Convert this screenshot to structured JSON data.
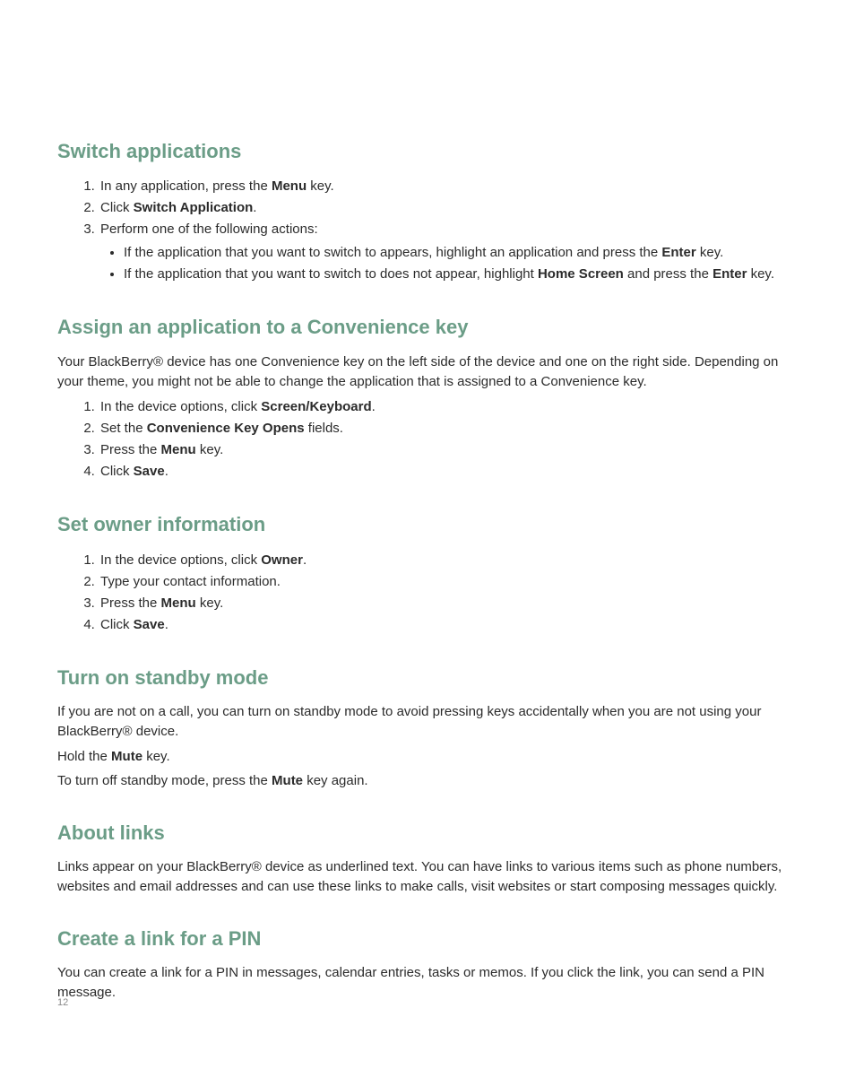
{
  "page_number": "12",
  "sections": [
    {
      "heading": "Switch applications",
      "paragraphs": [],
      "list": {
        "type": "ol",
        "items": [
          {
            "parts": [
              {
                "t": "In any application, press the "
              },
              {
                "b": "Menu"
              },
              {
                "t": " key."
              }
            ]
          },
          {
            "parts": [
              {
                "t": "Click "
              },
              {
                "b": "Switch Application"
              },
              {
                "t": "."
              }
            ]
          },
          {
            "parts": [
              {
                "t": "Perform one of the following actions:"
              }
            ],
            "sublist": {
              "type": "ul",
              "items": [
                {
                  "parts": [
                    {
                      "t": "If the application that you want to switch to appears, highlight an application and press the "
                    },
                    {
                      "b": "Enter"
                    },
                    {
                      "t": " key."
                    }
                  ]
                },
                {
                  "parts": [
                    {
                      "t": "If the application that you want to switch to does not appear, highlight "
                    },
                    {
                      "b": "Home Screen"
                    },
                    {
                      "t": " and press the "
                    },
                    {
                      "b": "Enter"
                    },
                    {
                      "t": " key."
                    }
                  ]
                }
              ]
            }
          }
        ]
      },
      "post_paragraphs": []
    },
    {
      "heading": "Assign an application to a Convenience key",
      "paragraphs": [
        {
          "parts": [
            {
              "t": "Your BlackBerry® device has one Convenience key on the left side of the device and one on the right side. Depending on your theme, you might not be able to change the application that is assigned to a Convenience key."
            }
          ]
        }
      ],
      "list": {
        "type": "ol",
        "items": [
          {
            "parts": [
              {
                "t": "In the device options, click "
              },
              {
                "b": "Screen/Keyboard"
              },
              {
                "t": "."
              }
            ]
          },
          {
            "parts": [
              {
                "t": "Set the "
              },
              {
                "b": "Convenience Key Opens"
              },
              {
                "t": " fields."
              }
            ]
          },
          {
            "parts": [
              {
                "t": "Press the "
              },
              {
                "b": "Menu"
              },
              {
                "t": " key."
              }
            ]
          },
          {
            "parts": [
              {
                "t": "Click "
              },
              {
                "b": "Save"
              },
              {
                "t": "."
              }
            ]
          }
        ]
      },
      "post_paragraphs": []
    },
    {
      "heading": "Set owner information",
      "paragraphs": [],
      "list": {
        "type": "ol",
        "items": [
          {
            "parts": [
              {
                "t": "In the device options, click "
              },
              {
                "b": "Owner"
              },
              {
                "t": "."
              }
            ]
          },
          {
            "parts": [
              {
                "t": "Type your contact information."
              }
            ]
          },
          {
            "parts": [
              {
                "t": "Press the "
              },
              {
                "b": "Menu"
              },
              {
                "t": " key."
              }
            ]
          },
          {
            "parts": [
              {
                "t": "Click "
              },
              {
                "b": "Save"
              },
              {
                "t": "."
              }
            ]
          }
        ]
      },
      "post_paragraphs": []
    },
    {
      "heading": "Turn on standby mode",
      "paragraphs": [
        {
          "parts": [
            {
              "t": "If you are not on a call, you can turn on standby mode to avoid pressing keys accidentally when you are not using your BlackBerry® device."
            }
          ]
        },
        {
          "parts": [
            {
              "t": "Hold the "
            },
            {
              "b": "Mute"
            },
            {
              "t": " key."
            }
          ]
        },
        {
          "parts": [
            {
              "t": "To turn off standby mode, press the "
            },
            {
              "b": "Mute"
            },
            {
              "t": " key again."
            }
          ]
        }
      ],
      "list": null,
      "post_paragraphs": []
    },
    {
      "heading": "About links",
      "paragraphs": [
        {
          "parts": [
            {
              "t": "Links appear on your BlackBerry® device as underlined text. You can have links to various items such as phone numbers, websites and email addresses and can use these links to make calls, visit websites or start composing messages quickly."
            }
          ]
        }
      ],
      "list": null,
      "post_paragraphs": []
    },
    {
      "heading": "Create a link for a PIN",
      "paragraphs": [
        {
          "parts": [
            {
              "t": "You can create a link for a PIN in messages, calendar entries, tasks or memos. If you click the link, you can send a PIN message."
            }
          ]
        }
      ],
      "list": null,
      "post_paragraphs": []
    }
  ]
}
